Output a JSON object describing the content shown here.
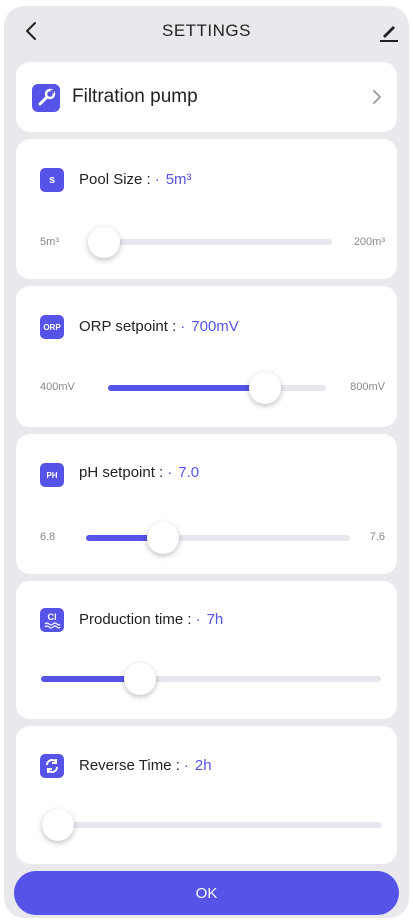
{
  "header": {
    "title": "SETTINGS",
    "back_icon": "chevron-left-icon",
    "edit_icon": "pencil-icon"
  },
  "pump": {
    "label": "Filtration pump",
    "icon": "wrench-icon",
    "chevron_icon": "chevron-right-icon"
  },
  "settings": [
    {
      "key": "pool_size",
      "label": "Pool Size :",
      "value": "5m³",
      "icon": "pool-size-icon",
      "icon_text": "",
      "min_label": "5m³",
      "max_label": "200m³",
      "level": 0.0
    },
    {
      "key": "orp",
      "label": "ORP setpoint :",
      "value": "700mV",
      "icon": "orp-icon",
      "icon_text": "ORP",
      "min_label": "400mV",
      "max_label": "800mV",
      "level": 0.72
    },
    {
      "key": "ph",
      "label": "pH setpoint :",
      "value": "7.0",
      "icon": "ph-icon",
      "icon_text": "PH",
      "min_label": "6.8",
      "max_label": "7.6",
      "level": 0.29
    },
    {
      "key": "production",
      "label": "Production time :",
      "value": "7h",
      "icon": "chlorine-icon",
      "icon_text": "",
      "min_label": "",
      "max_label": "",
      "level": 0.29
    },
    {
      "key": "reverse",
      "label": "Reverse Time :",
      "value": "2h",
      "icon": "reverse-icon",
      "icon_text": "",
      "min_label": "",
      "max_label": "",
      "level": 0.0
    }
  ],
  "footer": {
    "ok_label": "OK"
  },
  "colors": {
    "accent": "#5553e8",
    "background": "#e9e9ed",
    "track": "#e6e6ec"
  }
}
